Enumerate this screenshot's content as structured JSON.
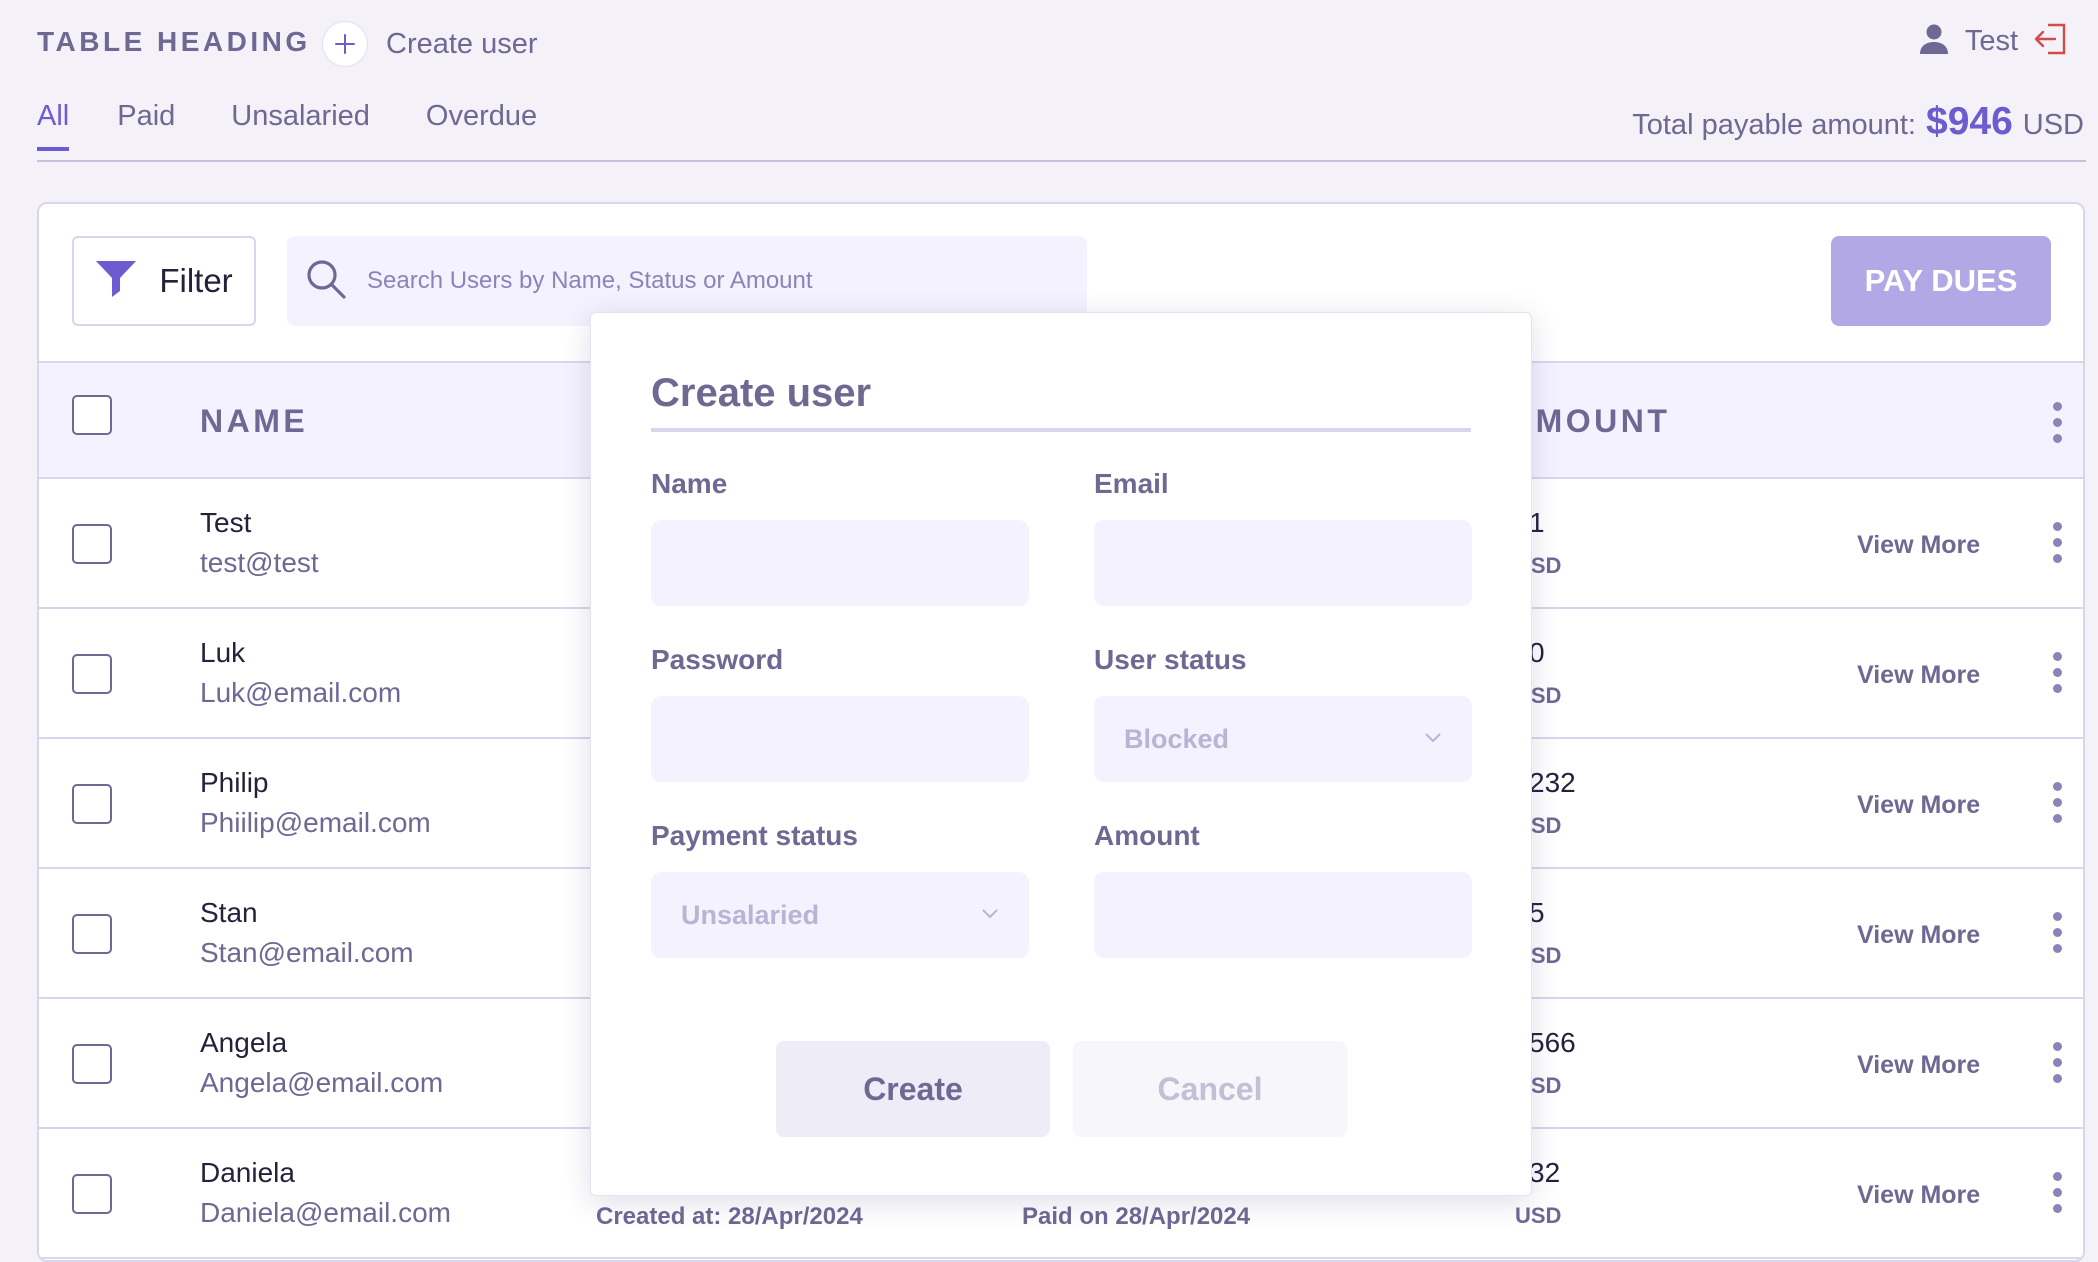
{
  "header": {
    "table_heading": "TABLE HEADING",
    "create_user_label": "Create user",
    "user_name": "Test"
  },
  "tabs": [
    {
      "label": "All",
      "active": true
    },
    {
      "label": "Paid",
      "active": false
    },
    {
      "label": "Unsalaried",
      "active": false
    },
    {
      "label": "Overdue",
      "active": false
    }
  ],
  "total": {
    "label": "Total payable amount:",
    "amount": "$946",
    "currency": "USD"
  },
  "toolbar": {
    "filter_label": "Filter",
    "search_placeholder": "Search Users by Name, Status or Amount",
    "pay_dues_label": "PAY DUES"
  },
  "table": {
    "columns": {
      "name": "NAME",
      "amount": "AMOUNT"
    },
    "view_more_label": "View More",
    "rows": [
      {
        "name": "Test",
        "email": "test@test",
        "amount": "1",
        "currency": "USD"
      },
      {
        "name": "Luk",
        "email": "Luk@email.com",
        "amount": "0",
        "currency": "USD"
      },
      {
        "name": "Philip",
        "email": "Phiilip@email.com",
        "amount": "232",
        "currency": "USD"
      },
      {
        "name": "Stan",
        "email": "Stan@email.com",
        "amount": "5",
        "currency": "USD"
      },
      {
        "name": "Angela",
        "email": "Angela@email.com",
        "amount": "566",
        "currency": "USD"
      },
      {
        "name": "Daniela",
        "email": "Daniela@email.com",
        "amount": "32",
        "currency": "USD",
        "created": "Created at: 28/Apr/2024",
        "paid": "Paid on 28/Apr/2024"
      }
    ]
  },
  "modal": {
    "title": "Create user",
    "name_label": "Name",
    "email_label": "Email",
    "password_label": "Password",
    "user_status_label": "User status",
    "user_status_value": "Blocked",
    "payment_status_label": "Payment status",
    "payment_status_value": "Unsalaried",
    "amount_label": "Amount",
    "create_label": "Create",
    "cancel_label": "Cancel"
  },
  "colors": {
    "accent": "#6d5bd0",
    "muted_text": "#6e6893",
    "pay_dues_bg": "#b3a8e6",
    "logout_icon": "#d14b4b"
  },
  "icons": [
    "plus-icon",
    "user-icon",
    "logout-icon",
    "filter-icon",
    "search-icon",
    "kebab-menu-icon",
    "chevron-down-icon"
  ]
}
